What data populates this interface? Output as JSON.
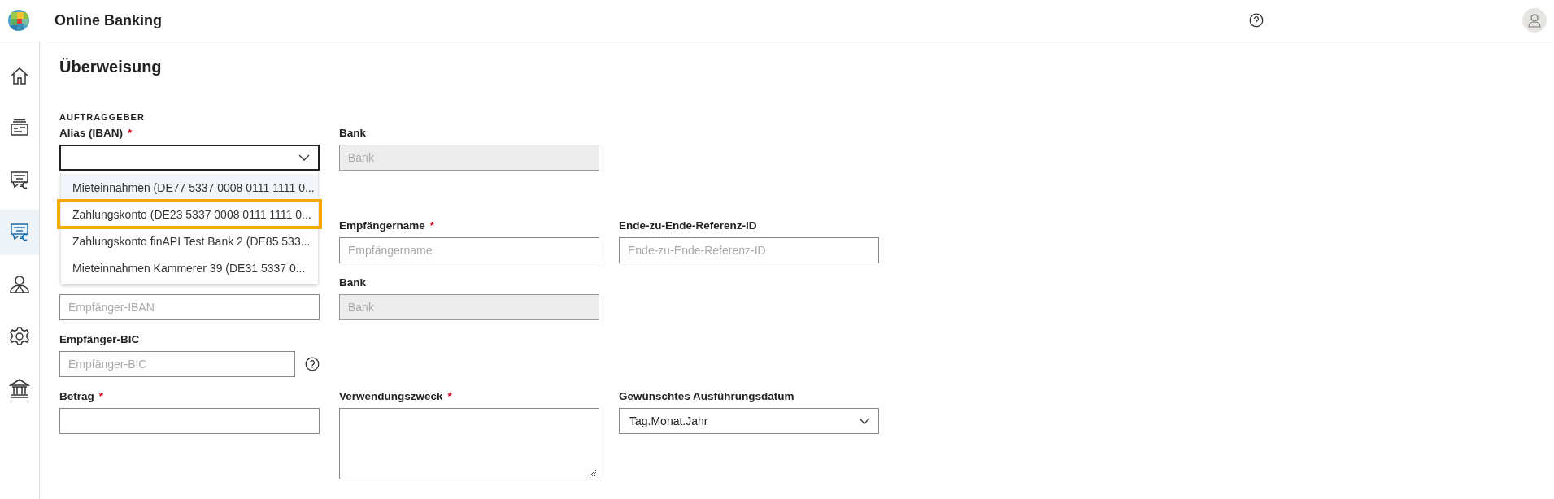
{
  "header": {
    "title": "Online Banking"
  },
  "sidebar": {
    "items": [
      {
        "selected": false
      },
      {
        "selected": false
      },
      {
        "selected": false
      },
      {
        "selected": true
      },
      {
        "selected": false
      },
      {
        "selected": false
      },
      {
        "selected": false
      }
    ]
  },
  "page_title": "Überweisung",
  "sections": [
    {
      "title": "AUFTRAGGEBER",
      "rows": [
        [
          {
            "kind": "select",
            "label": "Alias (IBAN)",
            "required_mark": "*",
            "open": true,
            "options": [
              {
                "label": "Mieteinnahmen (DE77 5337 0008 0111 1111 0...",
                "hovered": true,
                "selected": false
              },
              {
                "label": "Zahlungskonto (DE23 5337 0008 0111 1111 0...",
                "hovered": false,
                "selected": true
              },
              {
                "label": "Zahlungskonto finAPI Test Bank 2 (DE85 533...",
                "hovered": false,
                "selected": false
              },
              {
                "label": "Mieteinnahmen Kammerer 39 (DE31 5337 0...",
                "hovered": false,
                "selected": false
              }
            ]
          },
          {
            "kind": "input",
            "label": "Bank",
            "placeholder": "Bank",
            "disabled": true
          }
        ]
      ]
    },
    {
      "rows": [
        [
          {
            "kind": "blank"
          },
          {
            "kind": "input",
            "label": "Empfängername",
            "required_mark": "*",
            "placeholder": "Empfängername",
            "disabled": false
          },
          {
            "kind": "input",
            "label": "Ende-zu-Ende-Referenz-ID",
            "placeholder": "Ende-zu-Ende-Referenz-ID",
            "disabled": false
          }
        ],
        [
          {
            "kind": "input",
            "placeholder": "Empfänger-IBAN",
            "disabled": false
          },
          {
            "kind": "input",
            "label": "Bank",
            "placeholder": "Bank",
            "disabled": true
          }
        ],
        [
          {
            "kind": "input",
            "label": "Empfänger-BIC",
            "placeholder": "Empfänger-BIC",
            "disabled": false,
            "help": true
          }
        ],
        [
          {
            "kind": "input",
            "label": "Betrag",
            "required_mark": "*",
            "disabled": false
          },
          {
            "kind": "textarea",
            "label": "Verwendungszweck",
            "required_mark": "*"
          },
          {
            "kind": "select",
            "label": "Gewünschtes Ausführungsdatum",
            "value": "Tag.Monat.Jahr",
            "open": false
          }
        ]
      ]
    }
  ]
}
